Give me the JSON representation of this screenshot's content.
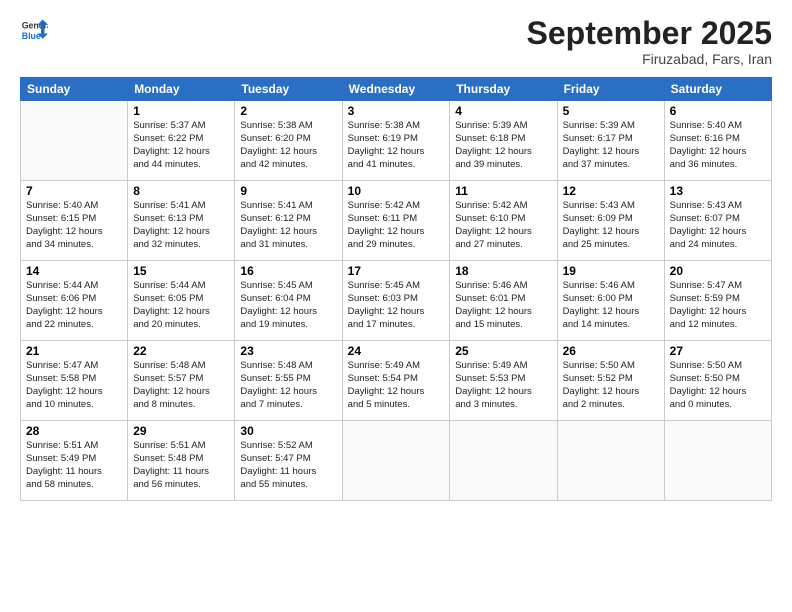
{
  "logo": {
    "general": "General",
    "blue": "Blue"
  },
  "header": {
    "month": "September 2025",
    "location": "Firuzabad, Fars, Iran"
  },
  "days_of_week": [
    "Sunday",
    "Monday",
    "Tuesday",
    "Wednesday",
    "Thursday",
    "Friday",
    "Saturday"
  ],
  "weeks": [
    [
      {
        "day": "",
        "info": ""
      },
      {
        "day": "1",
        "info": "Sunrise: 5:37 AM\nSunset: 6:22 PM\nDaylight: 12 hours\nand 44 minutes."
      },
      {
        "day": "2",
        "info": "Sunrise: 5:38 AM\nSunset: 6:20 PM\nDaylight: 12 hours\nand 42 minutes."
      },
      {
        "day": "3",
        "info": "Sunrise: 5:38 AM\nSunset: 6:19 PM\nDaylight: 12 hours\nand 41 minutes."
      },
      {
        "day": "4",
        "info": "Sunrise: 5:39 AM\nSunset: 6:18 PM\nDaylight: 12 hours\nand 39 minutes."
      },
      {
        "day": "5",
        "info": "Sunrise: 5:39 AM\nSunset: 6:17 PM\nDaylight: 12 hours\nand 37 minutes."
      },
      {
        "day": "6",
        "info": "Sunrise: 5:40 AM\nSunset: 6:16 PM\nDaylight: 12 hours\nand 36 minutes."
      }
    ],
    [
      {
        "day": "7",
        "info": "Sunrise: 5:40 AM\nSunset: 6:15 PM\nDaylight: 12 hours\nand 34 minutes."
      },
      {
        "day": "8",
        "info": "Sunrise: 5:41 AM\nSunset: 6:13 PM\nDaylight: 12 hours\nand 32 minutes."
      },
      {
        "day": "9",
        "info": "Sunrise: 5:41 AM\nSunset: 6:12 PM\nDaylight: 12 hours\nand 31 minutes."
      },
      {
        "day": "10",
        "info": "Sunrise: 5:42 AM\nSunset: 6:11 PM\nDaylight: 12 hours\nand 29 minutes."
      },
      {
        "day": "11",
        "info": "Sunrise: 5:42 AM\nSunset: 6:10 PM\nDaylight: 12 hours\nand 27 minutes."
      },
      {
        "day": "12",
        "info": "Sunrise: 5:43 AM\nSunset: 6:09 PM\nDaylight: 12 hours\nand 25 minutes."
      },
      {
        "day": "13",
        "info": "Sunrise: 5:43 AM\nSunset: 6:07 PM\nDaylight: 12 hours\nand 24 minutes."
      }
    ],
    [
      {
        "day": "14",
        "info": "Sunrise: 5:44 AM\nSunset: 6:06 PM\nDaylight: 12 hours\nand 22 minutes."
      },
      {
        "day": "15",
        "info": "Sunrise: 5:44 AM\nSunset: 6:05 PM\nDaylight: 12 hours\nand 20 minutes."
      },
      {
        "day": "16",
        "info": "Sunrise: 5:45 AM\nSunset: 6:04 PM\nDaylight: 12 hours\nand 19 minutes."
      },
      {
        "day": "17",
        "info": "Sunrise: 5:45 AM\nSunset: 6:03 PM\nDaylight: 12 hours\nand 17 minutes."
      },
      {
        "day": "18",
        "info": "Sunrise: 5:46 AM\nSunset: 6:01 PM\nDaylight: 12 hours\nand 15 minutes."
      },
      {
        "day": "19",
        "info": "Sunrise: 5:46 AM\nSunset: 6:00 PM\nDaylight: 12 hours\nand 14 minutes."
      },
      {
        "day": "20",
        "info": "Sunrise: 5:47 AM\nSunset: 5:59 PM\nDaylight: 12 hours\nand 12 minutes."
      }
    ],
    [
      {
        "day": "21",
        "info": "Sunrise: 5:47 AM\nSunset: 5:58 PM\nDaylight: 12 hours\nand 10 minutes."
      },
      {
        "day": "22",
        "info": "Sunrise: 5:48 AM\nSunset: 5:57 PM\nDaylight: 12 hours\nand 8 minutes."
      },
      {
        "day": "23",
        "info": "Sunrise: 5:48 AM\nSunset: 5:55 PM\nDaylight: 12 hours\nand 7 minutes."
      },
      {
        "day": "24",
        "info": "Sunrise: 5:49 AM\nSunset: 5:54 PM\nDaylight: 12 hours\nand 5 minutes."
      },
      {
        "day": "25",
        "info": "Sunrise: 5:49 AM\nSunset: 5:53 PM\nDaylight: 12 hours\nand 3 minutes."
      },
      {
        "day": "26",
        "info": "Sunrise: 5:50 AM\nSunset: 5:52 PM\nDaylight: 12 hours\nand 2 minutes."
      },
      {
        "day": "27",
        "info": "Sunrise: 5:50 AM\nSunset: 5:50 PM\nDaylight: 12 hours\nand 0 minutes."
      }
    ],
    [
      {
        "day": "28",
        "info": "Sunrise: 5:51 AM\nSunset: 5:49 PM\nDaylight: 11 hours\nand 58 minutes."
      },
      {
        "day": "29",
        "info": "Sunrise: 5:51 AM\nSunset: 5:48 PM\nDaylight: 11 hours\nand 56 minutes."
      },
      {
        "day": "30",
        "info": "Sunrise: 5:52 AM\nSunset: 5:47 PM\nDaylight: 11 hours\nand 55 minutes."
      },
      {
        "day": "",
        "info": ""
      },
      {
        "day": "",
        "info": ""
      },
      {
        "day": "",
        "info": ""
      },
      {
        "day": "",
        "info": ""
      }
    ]
  ]
}
